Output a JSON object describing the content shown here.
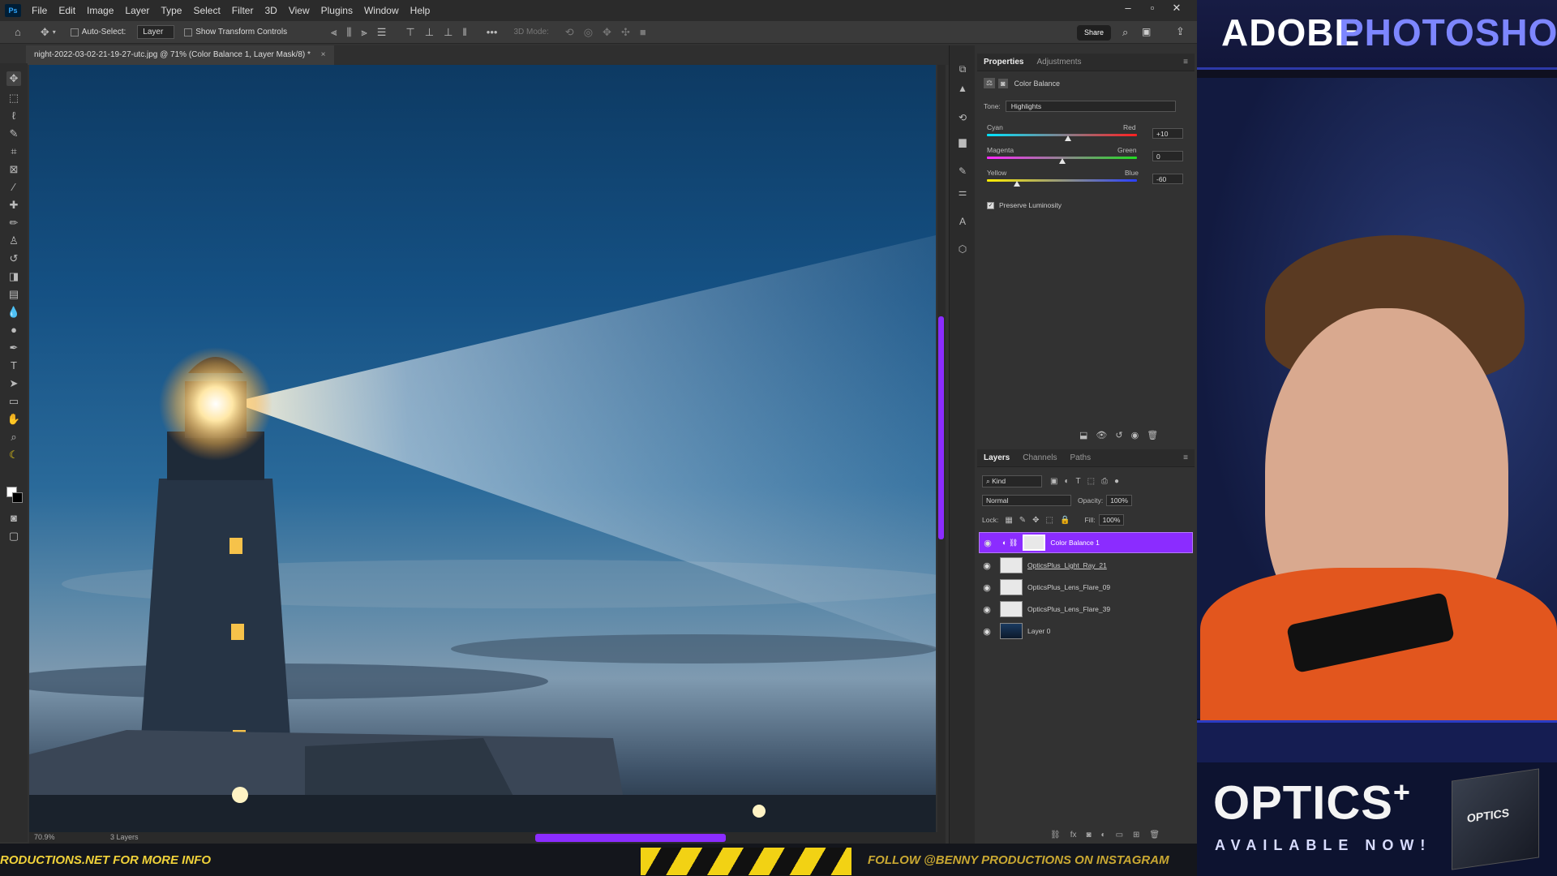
{
  "menubar": {
    "app_icon": "Ps",
    "items": [
      "File",
      "Edit",
      "Image",
      "Layer",
      "Type",
      "Select",
      "Filter",
      "3D",
      "View",
      "Plugins",
      "Window",
      "Help"
    ]
  },
  "options_bar": {
    "auto_select_label": "Auto-Select:",
    "auto_select_target": "Layer",
    "show_transform_label": "Show Transform Controls",
    "mode_3d_label": "3D Mode:",
    "share_label": "Share"
  },
  "document_tab": {
    "title": "night-2022-03-02-21-19-27-utc.jpg @ 71% (Color Balance 1, Layer Mask/8) *",
    "close": "×"
  },
  "status_bar": {
    "zoom": "70.9%",
    "layers_count": "3 Layers"
  },
  "properties_panel": {
    "tabs": [
      "Properties",
      "Adjustments"
    ],
    "adjustment_name": "Color Balance",
    "tone_label": "Tone:",
    "tone_value": "Highlights",
    "sliders": [
      {
        "left": "Cyan",
        "right": "Red",
        "value": "+10",
        "level": 0.54
      },
      {
        "left": "Magenta",
        "right": "Green",
        "value": "0",
        "level": 0.5
      },
      {
        "left": "Yellow",
        "right": "Blue",
        "value": "-60",
        "level": 0.2
      }
    ],
    "preserve_luminosity_label": "Preserve Luminosity",
    "preserve_luminosity_checked": true
  },
  "layers_panel": {
    "tabs": [
      "Layers",
      "Channels",
      "Paths"
    ],
    "filter_kind": "Kind",
    "blend_mode": "Normal",
    "opacity_label": "Opacity:",
    "opacity_value": "100%",
    "lock_label": "Lock:",
    "fill_label": "Fill:",
    "fill_value": "100%",
    "layers": [
      {
        "name": "Color Balance 1",
        "selected": true
      },
      {
        "name": "OpticsPlus_Light_Ray_21",
        "selected": false
      },
      {
        "name": "OpticsPlus_Lens_Flare_09",
        "selected": false
      },
      {
        "name": "OpticsPlus_Lens_Flare_39",
        "selected": false
      },
      {
        "name": "Layer 0",
        "selected": false
      }
    ]
  },
  "overlay": {
    "banner_word1": "ADOBE",
    "banner_word2": "PHOTOSHOP",
    "product_title": "OPTICS",
    "product_plus": "+",
    "product_subtitle": "AVAILABLE NOW!",
    "box_label": "OPTICS"
  },
  "ticker": {
    "left_text": "RODUCTIONS.NET FOR MORE INFO",
    "right_text": "FOLLOW @BENNY PRODUCTIONS ON INSTAGRAM"
  },
  "colors": {
    "accent_purple": "#8b2cff",
    "banner_blue": "#2d39a8",
    "ticker_yellow": "#f0d23a",
    "hoodie_orange": "#e2561e"
  }
}
